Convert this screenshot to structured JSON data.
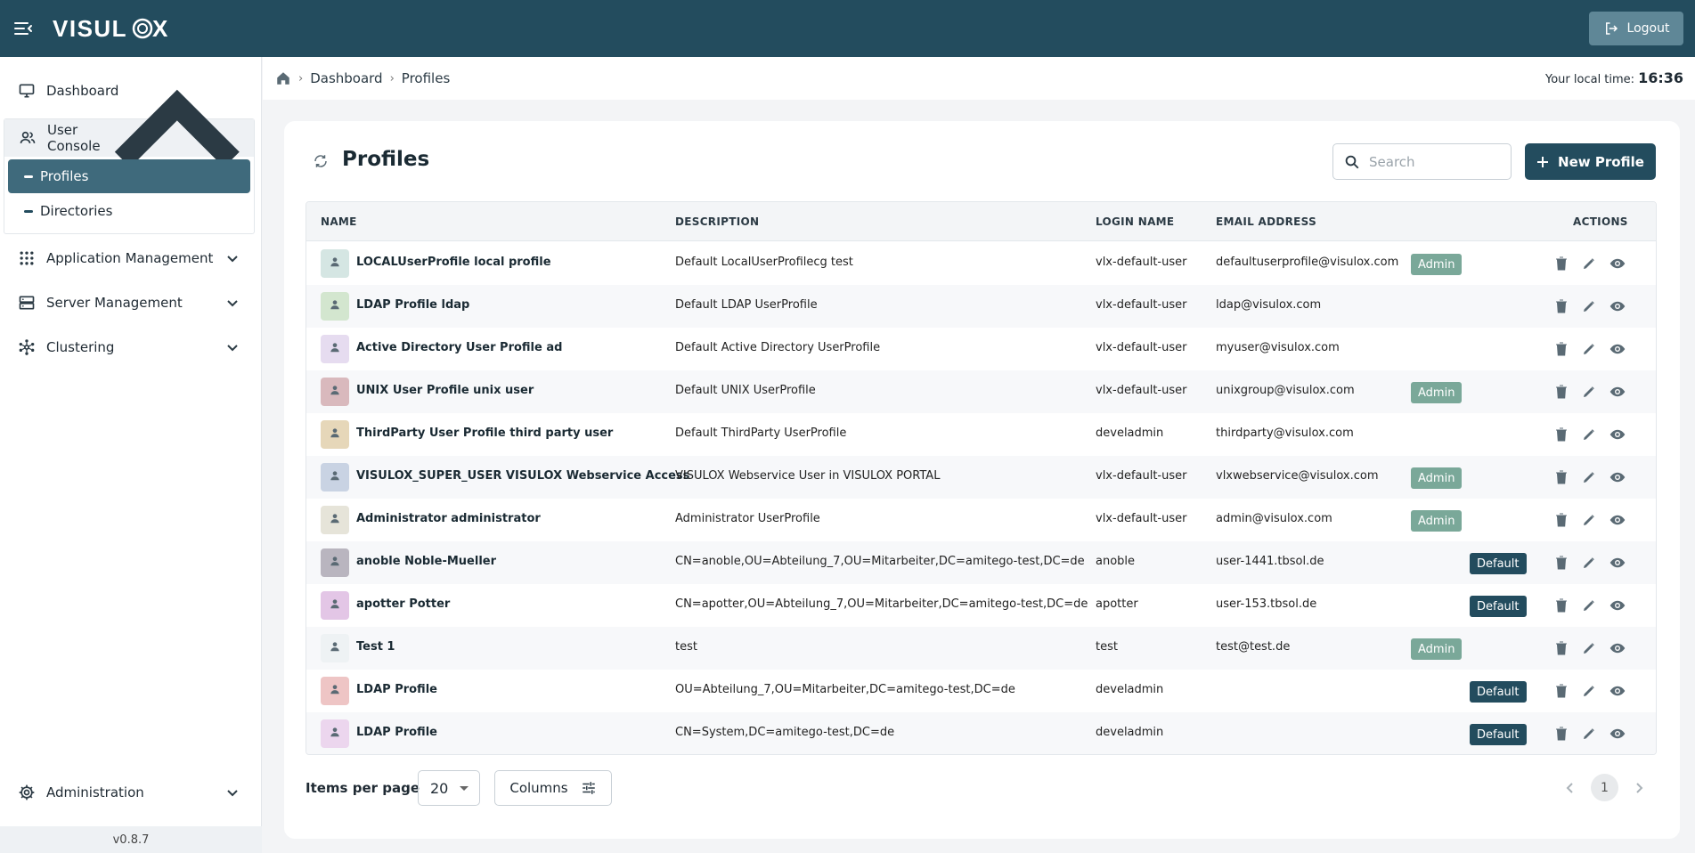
{
  "app": {
    "brand": "VISULOX",
    "logout_label": "Logout"
  },
  "sidebar": {
    "dashboard": "Dashboard",
    "user_console": "User Console",
    "sub_items": [
      "Profiles",
      "Directories"
    ],
    "application_management": "Application Management",
    "server_management": "Server Management",
    "clustering": "Clustering",
    "administration": "Administration",
    "version": "v0.8.7"
  },
  "breadcrumb": {
    "items": [
      "Dashboard",
      "Profiles"
    ]
  },
  "local_time": {
    "label": "Your local time:",
    "value": "16:36"
  },
  "page": {
    "title": "Profiles",
    "search_placeholder": "Search",
    "new_button": "New Profile"
  },
  "table": {
    "headers": {
      "name": "NAME",
      "description": "DESCRIPTION",
      "login": "LOGIN NAME",
      "email": "EMAIL ADDRESS",
      "actions": "ACTIONS"
    },
    "rows": [
      {
        "name": "LOCALUserProfile local profile",
        "description": "Default LocalUserProfilecg test",
        "login": "vlx-default-user",
        "email": "defaultuserprofile@visulox.com",
        "badge": "Admin",
        "avatar_color": "#d5e6e3"
      },
      {
        "name": "LDAP Profile ldap",
        "description": "Default LDAP UserProfile",
        "login": "vlx-default-user",
        "email": "ldap@visulox.com",
        "badge": "",
        "avatar_color": "#d3e6cf"
      },
      {
        "name": "Active Directory User Profile ad",
        "description": "Default Active Directory UserProfile",
        "login": "vlx-default-user",
        "email": "myuser@visulox.com",
        "badge": "",
        "avatar_color": "#e6dcf0"
      },
      {
        "name": "UNIX User Profile unix user",
        "description": "Default UNIX UserProfile",
        "login": "vlx-default-user",
        "email": "unixgroup@visulox.com",
        "badge": "Admin",
        "avatar_color": "#d9b9bd"
      },
      {
        "name": "ThirdParty User Profile third party user",
        "description": "Default ThirdParty UserProfile",
        "login": "develadmin",
        "email": "thirdparty@visulox.com",
        "badge": "",
        "avatar_color": "#e6d7b9"
      },
      {
        "name": "VISULOX_SUPER_USER VISULOX Webservice Access",
        "description": "VISULOX Webservice User in VISULOX PORTAL",
        "login": "vlx-default-user",
        "email": "vlxwebservice@visulox.com",
        "badge": "Admin",
        "avatar_color": "#c9d3e3"
      },
      {
        "name": "Administrator administrator",
        "description": "Administrator UserProfile",
        "login": "vlx-default-user",
        "email": "admin@visulox.com",
        "badge": "Admin",
        "avatar_color": "#e6e4d9"
      },
      {
        "name": "anoble Noble-Mueller",
        "description": "CN=anoble,OU=Abteilung_7,OU=Mitarbeiter,DC=amitego-test,DC=de",
        "login": "anoble",
        "email": "user-1441.tbsol.de",
        "badge": "Default",
        "avatar_color": "#b9b5bf"
      },
      {
        "name": "apotter Potter",
        "description": "CN=apotter,OU=Abteilung_7,OU=Mitarbeiter,DC=amitego-test,DC=de",
        "login": "apotter",
        "email": "user-153.tbsol.de",
        "badge": "Default",
        "avatar_color": "#e3c6e6"
      },
      {
        "name": "Test 1",
        "description": "test",
        "login": "test",
        "email": "test@test.de",
        "badge": "Admin",
        "avatar_color": "#eef2f4"
      },
      {
        "name": "LDAP Profile",
        "description": "OU=Abteilung_7,OU=Mitarbeiter,DC=amitego-test,DC=de",
        "login": "develadmin",
        "email": "",
        "badge": "Default",
        "avatar_color": "#eec5c5"
      },
      {
        "name": "LDAP Profile",
        "description": "CN=System,DC=amitego-test,DC=de",
        "login": "develadmin",
        "email": "",
        "badge": "Default",
        "avatar_color": "#ecd6ee"
      }
    ]
  },
  "footer": {
    "items_per_page_label": "Items per page",
    "items_per_page_value": "20",
    "columns_label": "Columns",
    "current_page": "1"
  }
}
